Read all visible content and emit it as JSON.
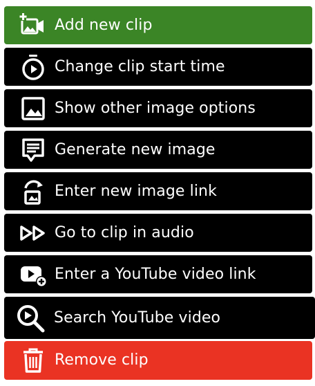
{
  "menu": {
    "items": [
      {
        "label": "Add new clip",
        "color": "#3b8526",
        "icon": "add-video-icon"
      },
      {
        "label": "Change clip start time",
        "color": "#000000",
        "icon": "stopwatch-icon"
      },
      {
        "label": "Show other image options",
        "color": "#000000",
        "icon": "image-icon"
      },
      {
        "label": "Generate new image",
        "color": "#000000",
        "icon": "message-text-icon"
      },
      {
        "label": "Enter new image link",
        "color": "#000000",
        "icon": "image-refresh-icon"
      },
      {
        "label": "Go to clip in audio",
        "color": "#000000",
        "icon": "fast-forward-icon"
      },
      {
        "label": "Enter a YouTube video link",
        "color": "#000000",
        "icon": "youtube-add-icon"
      },
      {
        "label": "Search YouTube video",
        "color": "#000000",
        "icon": "search-icon"
      },
      {
        "label": "Remove clip",
        "color": "#ea3323",
        "icon": "trash-icon"
      }
    ]
  }
}
